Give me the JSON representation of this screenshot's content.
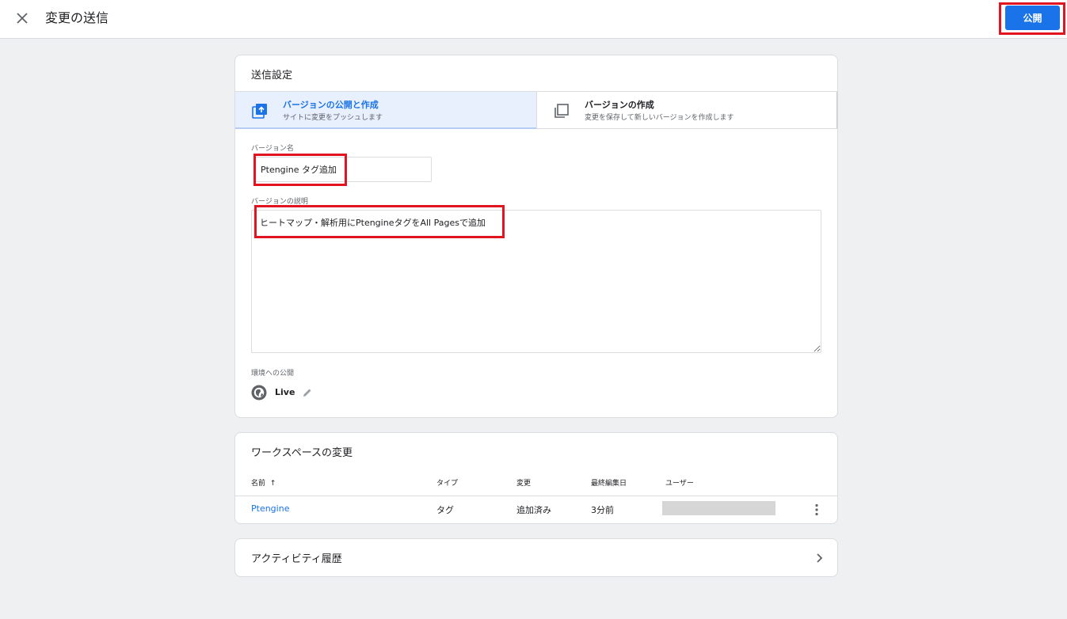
{
  "header": {
    "title": "変更の送信",
    "publish_label": "公開"
  },
  "submission": {
    "title": "送信設定",
    "options": [
      {
        "title": "バージョンの公開と作成",
        "subtitle": "サイトに変更をプッシュします",
        "icon": "publish-icon",
        "selected": true
      },
      {
        "title": "バージョンの作成",
        "subtitle": "変更を保存して新しいバージョンを作成します",
        "icon": "copy-icon",
        "selected": false
      }
    ],
    "version_name_label": "バージョン名",
    "version_name_value": "Ptengine タグ追加",
    "version_desc_label": "バージョンの説明",
    "version_desc_value": "ヒートマップ・解析用にPtengineタグをAll Pagesで追加",
    "env_label": "環境への公開",
    "env_name": "Live",
    "env_icon": "globe-icon"
  },
  "workspace_changes": {
    "title": "ワークスペースの変更",
    "columns": [
      "名前",
      "タイプ",
      "変更",
      "最終編集日",
      "ユーザー"
    ],
    "sort_indicator": "↑",
    "rows": [
      {
        "name": "Ptengine",
        "type": "タグ",
        "change": "追加済み",
        "edited": "3分前",
        "user": ""
      }
    ]
  },
  "activity": {
    "title": "アクティビティ履歴"
  },
  "colors": {
    "accent": "#1a73e8",
    "highlight": "#e1141f",
    "selected_bg": "#e8f0fe",
    "page_bg": "#eef0f2"
  }
}
